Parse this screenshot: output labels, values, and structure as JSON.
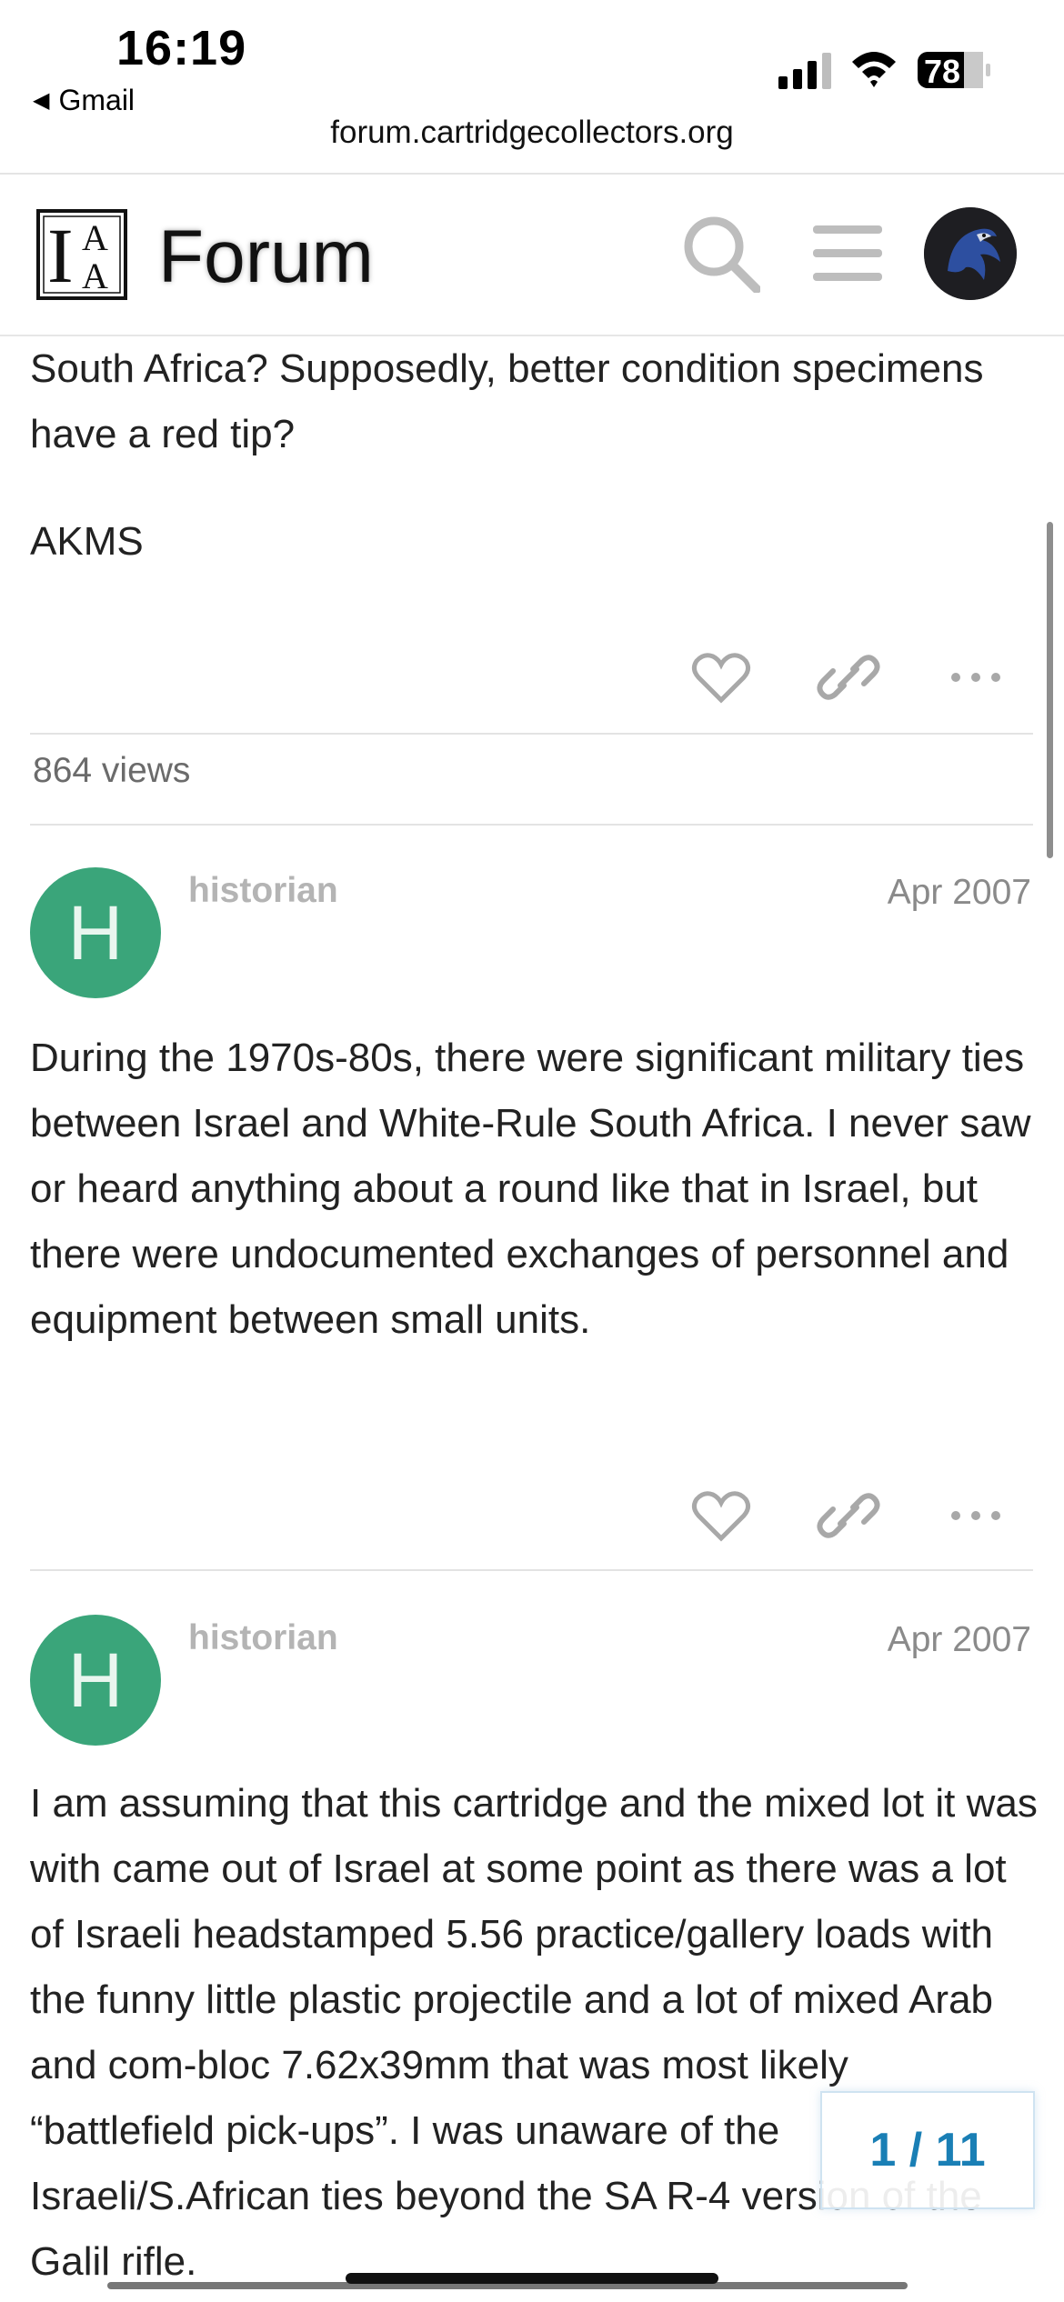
{
  "status_bar": {
    "time": "16:19",
    "back_app": "Gmail",
    "battery": "78",
    "url": "forum.cartridgecollectors.org"
  },
  "header": {
    "logo_top": "I",
    "logo_letters": [
      "A",
      "A"
    ],
    "title": "Forum"
  },
  "topic": {
    "prev_post_lines": "South Africa? Supposedly, better condition specimens have a red tip?",
    "signature": "AKMS",
    "views": "864 views"
  },
  "posts": [
    {
      "avatar_letter": "H",
      "username": "historian",
      "date": "Apr 2007",
      "body": "During the 1970s-80s, there were significant military ties between Israel and White-Rule South Africa. I never saw or heard anything about a round like that in Israel, but there were undocumented exchanges of personnel and equipment between small units."
    },
    {
      "avatar_letter": "H",
      "username": "historian",
      "date": "Apr 2007",
      "body": "I am assuming that this cartridge and the mixed lot it was with came out of Israel at some point as there was a lot of Israeli headstamped 5.56 practice/gallery loads with the funny little plastic projectile and a lot of mixed Arab and com-bloc 7.62x39mm that was most likely “battlefield pick-ups”. I was unaware of the Israeli/S.African ties beyond the SA R-4 version of the Galil rifle."
    }
  ],
  "progress": {
    "label": "1 / 11"
  },
  "colors": {
    "avatar_green": "#3aa57a",
    "counter_blue": "#1a7fb5"
  }
}
